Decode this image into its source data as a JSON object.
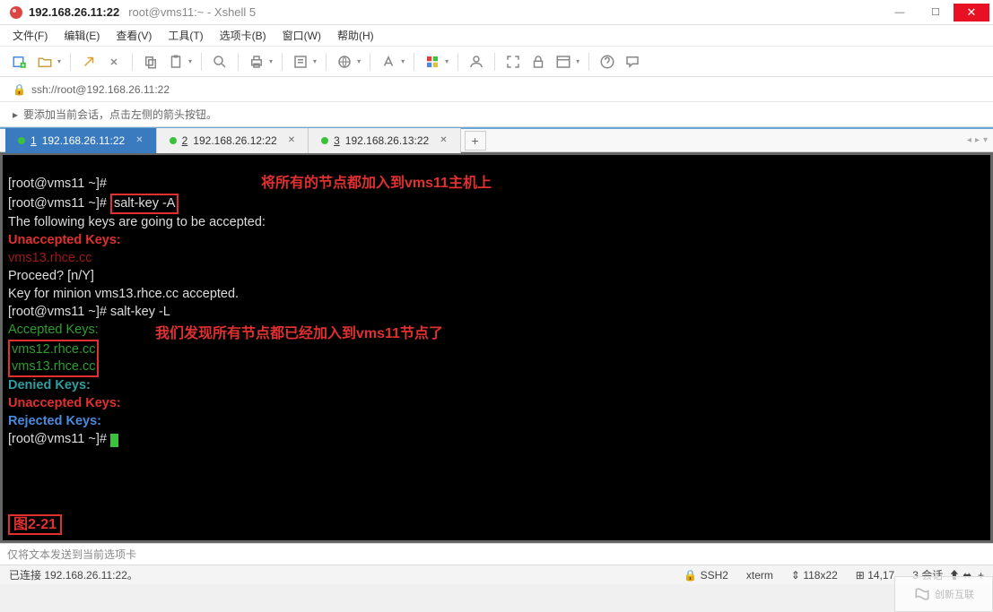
{
  "window": {
    "title": "192.168.26.11:22",
    "subtitle": "root@vms11:~ - Xshell 5"
  },
  "menu": {
    "file": "文件(F)",
    "edit": "编辑(E)",
    "view": "查看(V)",
    "tools": "工具(T)",
    "tabs": "选项卡(B)",
    "window": "窗口(W)",
    "help": "帮助(H)"
  },
  "address": {
    "url": "ssh://root@192.168.26.11:22"
  },
  "hint": {
    "text": "要添加当前会话，点击左侧的箭头按钮。"
  },
  "tabs": {
    "t1": {
      "num": "1",
      "label": "192.168.26.11:22"
    },
    "t2": {
      "num": "2",
      "label": "192.168.26.12:22"
    },
    "t3": {
      "num": "3",
      "label": "192.168.26.13:22"
    },
    "add": "+"
  },
  "terminal": {
    "line1": "[root@vms11 ~]# ",
    "line2a": "[root@vms11 ~]# ",
    "line2b": "salt-key -A",
    "annot1": "将所有的节点都加入到vms11主机上",
    "line3": "The following keys are going to be accepted:",
    "line4": "Unaccepted Keys:",
    "line5": "vms13.rhce.cc",
    "line6": "Proceed? [n/Y] ",
    "line7": "Key for minion vms13.rhce.cc accepted.",
    "line8": "[root@vms11 ~]# salt-key -L",
    "line9": "Accepted Keys:",
    "line10": "vms12.rhce.cc",
    "line11": "vms13.rhce.cc",
    "annot2": "我们发现所有节点都已经加入到vms11节点了",
    "line12": "Denied Keys:",
    "line13": "Unaccepted Keys:",
    "line14": "Rejected Keys:",
    "line15": "[root@vms11 ~]# ",
    "fig": "图2-21"
  },
  "sendbar": {
    "text": "仅将文本发送到当前选项卡"
  },
  "status": {
    "conn": "已连接 192.168.26.11:22。",
    "ssh": "SSH2",
    "term": "xterm",
    "size": "118x22",
    "pos": "14,17",
    "sessions_n": "3",
    "sessions_l": "会话"
  },
  "watermark": {
    "text": "创新互联"
  }
}
